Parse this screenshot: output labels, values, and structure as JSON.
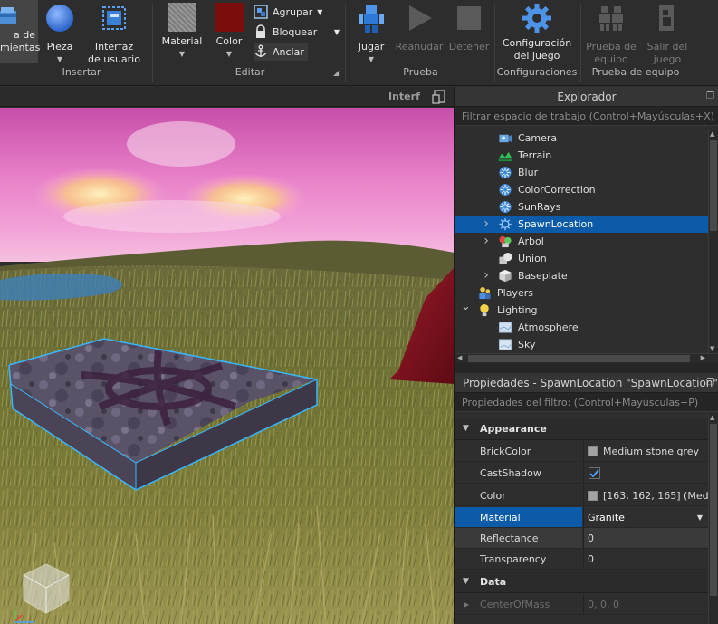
{
  "ribbon": {
    "tools_label": "a de\nmientas",
    "insert": {
      "part": "Pieza",
      "ui": "Interfaz\nde usuario",
      "group": "Insertar"
    },
    "edit": {
      "material": "Material",
      "color": "Color",
      "group_btn": "Agrupar",
      "lock": "Bloquear",
      "anchor": "Anclar",
      "group": "Editar"
    },
    "test": {
      "play": "Jugar",
      "resume": "Reanudar",
      "stop": "Detener",
      "group": "Prueba"
    },
    "settings": {
      "game_settings": "Configuración\ndel juego",
      "group": "Configuraciones"
    },
    "team_test": {
      "team_test": "Prueba de\nequipo",
      "exit_game": "Salir del\njuego",
      "group": "Prueba de equipo"
    }
  },
  "viewport": {
    "tab_label": "Interf"
  },
  "explorer": {
    "title": "Explorador",
    "filter_placeholder": "Filtrar espacio de trabajo (Control+Mayúsculas+X)",
    "items": [
      {
        "label": "Camera",
        "icon": "camera-icon",
        "level": 2,
        "expand": ""
      },
      {
        "label": "Terrain",
        "icon": "terrain-icon",
        "level": 2,
        "expand": ""
      },
      {
        "label": "Blur",
        "icon": "effect-icon",
        "level": 2,
        "expand": ""
      },
      {
        "label": "ColorCorrection",
        "icon": "effect-icon",
        "level": 2,
        "expand": ""
      },
      {
        "label": "SunRays",
        "icon": "effect-icon",
        "level": 2,
        "expand": ""
      },
      {
        "label": "SpawnLocation",
        "icon": "spawn-icon",
        "level": 2,
        "expand": "closed",
        "selected": true
      },
      {
        "label": "Arbol",
        "icon": "model-icon",
        "level": 2,
        "expand": "closed"
      },
      {
        "label": "Union",
        "icon": "union-icon",
        "level": 2,
        "expand": ""
      },
      {
        "label": "Baseplate",
        "icon": "part-icon",
        "level": 2,
        "expand": "closed"
      },
      {
        "label": "Players",
        "icon": "players-icon",
        "level": 1,
        "expand": ""
      },
      {
        "label": "Lighting",
        "icon": "lighting-icon",
        "level": 1,
        "expand": "open"
      },
      {
        "label": "Atmosphere",
        "icon": "atmosphere-icon",
        "level": 2,
        "expand": ""
      },
      {
        "label": "Sky",
        "icon": "sky-icon",
        "level": 2,
        "expand": ""
      }
    ]
  },
  "properties": {
    "title": "Propiedades - SpawnLocation \"SpawnLocation\"",
    "filter_placeholder": "Propiedades del filtro: (Control+Mayúsculas+P)",
    "section_appearance": "Appearance",
    "section_data": "Data",
    "rows": [
      {
        "name": "BrickColor",
        "value": "Medium stone grey",
        "kind": "swatch"
      },
      {
        "name": "CastShadow",
        "value": "",
        "kind": "check"
      },
      {
        "name": "Color",
        "value": "[163, 162, 165] (Med...",
        "kind": "swatch"
      },
      {
        "name": "Material",
        "value": "Granite",
        "kind": "dropdown"
      },
      {
        "name": "Reflectance",
        "value": "0",
        "kind": "text"
      },
      {
        "name": "Transparency",
        "value": "0",
        "kind": "text"
      }
    ],
    "data_rows": [
      {
        "name": "CenterOfMass",
        "value": "0, 0, 0"
      }
    ]
  },
  "colors": {
    "accent_selection": "#0b5ba8",
    "panel_bg": "#2e2e2e",
    "ribbon_bg": "#2d2d2d",
    "check_blue": "#4aa3ff",
    "material_swatch": "#8b8b8b",
    "color_swatch": "#7a0c0c"
  }
}
